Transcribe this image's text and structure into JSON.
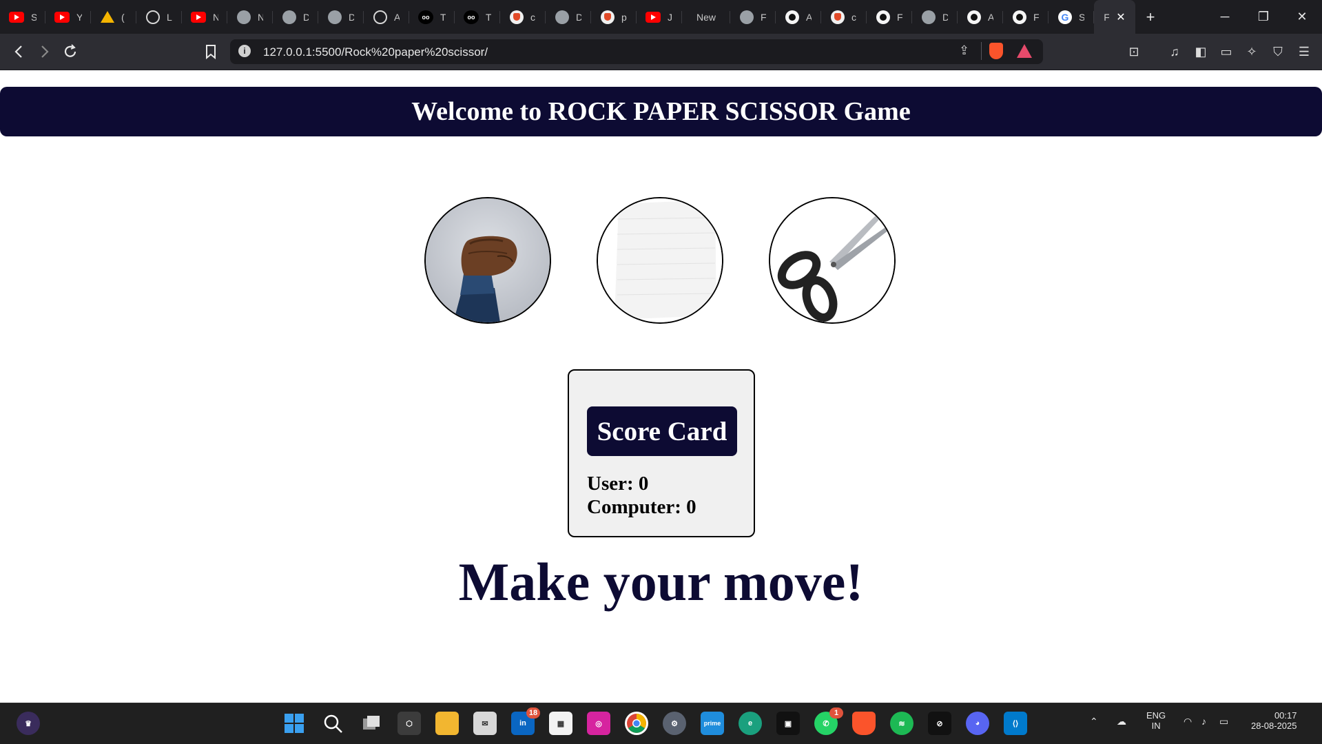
{
  "browser": {
    "tabs": [
      {
        "fav": "yt",
        "title": "S",
        "icon": "youtube-icon"
      },
      {
        "fav": "yt",
        "title": "Y",
        "icon": "youtube-icon"
      },
      {
        "fav": "drive",
        "title": "(",
        "icon": "google-drive-icon"
      },
      {
        "fav": "gpt",
        "title": "L",
        "icon": "chatgpt-icon"
      },
      {
        "fav": "yt",
        "title": "N",
        "icon": "youtube-icon"
      },
      {
        "fav": "globe",
        "title": "N",
        "icon": "globe-icon"
      },
      {
        "fav": "globe",
        "title": "D",
        "icon": "globe-icon"
      },
      {
        "fav": "globe",
        "title": "D",
        "icon": "globe-icon"
      },
      {
        "fav": "gpt",
        "title": "A",
        "icon": "chatgpt-icon"
      },
      {
        "fav": "oo",
        "title": "T",
        "icon": "oo-icon"
      },
      {
        "fav": "oo",
        "title": "T",
        "icon": "oo-icon"
      },
      {
        "fav": "brave",
        "title": "c",
        "icon": "brave-icon"
      },
      {
        "fav": "globe",
        "title": "D",
        "icon": "globe-icon"
      },
      {
        "fav": "brave",
        "title": "p",
        "icon": "brave-icon"
      },
      {
        "fav": "yt",
        "title": "J",
        "icon": "youtube-icon"
      }
    ],
    "new_tab_label": "New",
    "tabs2": [
      {
        "fav": "globe",
        "title": "F",
        "icon": "globe-icon"
      },
      {
        "fav": "gh",
        "title": "A",
        "icon": "github-icon"
      },
      {
        "fav": "brave",
        "title": "c",
        "icon": "brave-icon"
      },
      {
        "fav": "gh",
        "title": "F",
        "icon": "github-icon"
      },
      {
        "fav": "globe",
        "title": "D",
        "icon": "globe-icon"
      },
      {
        "fav": "gh",
        "title": "A",
        "icon": "github-icon"
      },
      {
        "fav": "gh",
        "title": "F",
        "icon": "github-icon"
      },
      {
        "fav": "goog",
        "title": "S",
        "icon": "google-icon"
      }
    ],
    "active_tab_title": "F",
    "url": "127.0.0.1:5500/Rock%20paper%20scissor/"
  },
  "page": {
    "title": "Welcome to ROCK PAPER SCISSOR Game",
    "choices": [
      "rock",
      "paper",
      "scissor"
    ],
    "score_card": {
      "title": "Score Card",
      "user_label": "User:",
      "user_score": "0",
      "computer_label": "Computer:",
      "computer_score": "0"
    },
    "message": "Make your move!"
  },
  "taskbar": {
    "linkedin_badge": "18",
    "whatsapp_badge": "1",
    "language": "ENG",
    "region": "IN",
    "time": "00:17",
    "date": "28-08-2025"
  }
}
